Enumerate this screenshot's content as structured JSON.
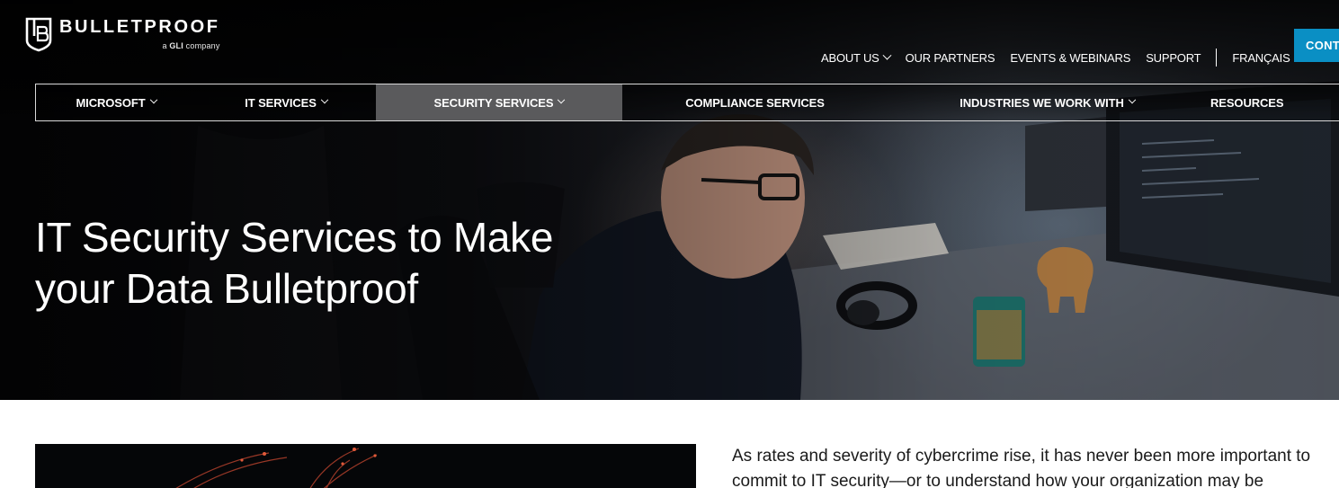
{
  "brand": {
    "name": "BULLETPROOF",
    "tagline_prefix": "a",
    "tagline_company": "GLI",
    "tagline_suffix": "company"
  },
  "utility_nav": {
    "items": [
      {
        "label": "ABOUT US",
        "has_dropdown": true
      },
      {
        "label": "OUR PARTNERS",
        "has_dropdown": false
      },
      {
        "label": "EVENTS & WEBINARS",
        "has_dropdown": false
      },
      {
        "label": "SUPPORT",
        "has_dropdown": false
      }
    ],
    "language": "FRANÇAIS",
    "contact_label": "CONTA",
    "contact_color": "#0a8fc4"
  },
  "main_nav": {
    "items": [
      {
        "label": "MICROSOFT",
        "has_dropdown": true,
        "active": false
      },
      {
        "label": "IT SERVICES",
        "has_dropdown": true,
        "active": false
      },
      {
        "label": "SECURITY SERVICES",
        "has_dropdown": true,
        "active": true
      },
      {
        "label": "COMPLIANCE SERVICES",
        "has_dropdown": false,
        "active": false
      },
      {
        "label": "INDUSTRIES WE WORK WITH",
        "has_dropdown": true,
        "active": false
      },
      {
        "label": "RESOURCES",
        "has_dropdown": false,
        "active": false
      }
    ],
    "active_color": "#5a5a5c"
  },
  "hero": {
    "title_line1": "IT Security Services to Make",
    "title_line2": "your Data Bulletproof"
  },
  "intro": {
    "line1": "As rates and severity of cybercrime rise, it has never been more important to",
    "line2": "commit to IT security—or to understand how your organization may be"
  }
}
